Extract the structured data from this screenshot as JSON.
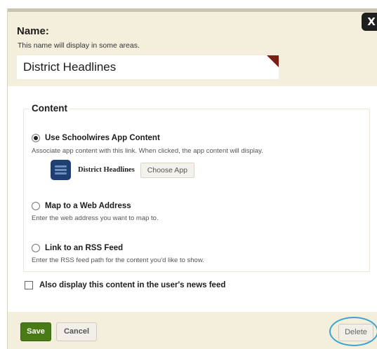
{
  "dialog": {
    "close_glyph": "X",
    "name": {
      "label": "Name:",
      "help": "This name will display in some areas.",
      "value": "District Headlines"
    },
    "content": {
      "legend": "Content",
      "options": [
        {
          "label": "Use Schoolwires App Content",
          "help": "Associate app content with this link. When clicked, the app content will display.",
          "selected": true
        },
        {
          "label": "Map to a Web Address",
          "help": "Enter the web address you want to map to.",
          "selected": false
        },
        {
          "label": "Link to an RSS Feed",
          "help": "Enter the RSS feed path for the content you'd like to show.",
          "selected": false
        }
      ],
      "app": {
        "icon": "list-app-icon",
        "name": "District Headlines",
        "choose_label": "Choose App"
      }
    },
    "news_feed": {
      "label": "Also display this content in the user's news feed",
      "checked": false
    },
    "footer": {
      "save_label": "Save",
      "cancel_label": "Cancel",
      "delete_label": "Delete"
    }
  },
  "colors": {
    "panel": "#f4eedc",
    "save": "#497a16",
    "required_marker": "#7a1f14",
    "highlight": "#3aa6d0"
  }
}
